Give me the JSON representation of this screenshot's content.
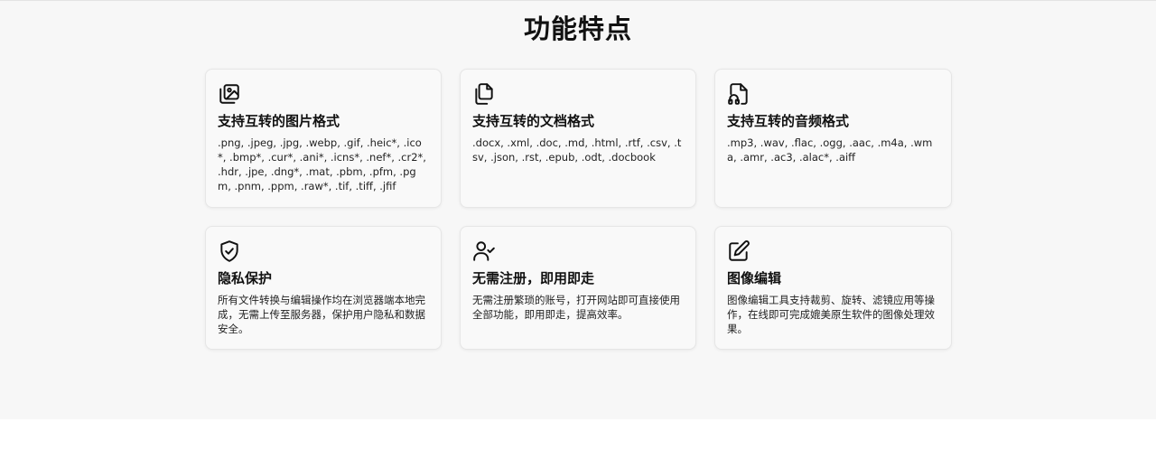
{
  "section": {
    "title": "功能特点"
  },
  "features": [
    {
      "icon": "image-gallery-icon",
      "title": "支持互转的图片格式",
      "description": ".png, .jpeg, .jpg, .webp, .gif, .heic*, .ico*, .bmp*, .cur*, .ani*, .icns*, .nef*, .cr2*, .hdr, .jpe, .dng*, .mat, .pbm, .pfm, .pgm, .pnm, .ppm, .raw*, .tif, .tiff, .jfif"
    },
    {
      "icon": "documents-icon",
      "title": "支持互转的文档格式",
      "description": ".docx, .xml, .doc, .md, .html, .rtf, .csv, .tsv, .json, .rst, .epub, .odt, .docbook"
    },
    {
      "icon": "audio-file-icon",
      "title": "支持互转的音频格式",
      "description": ".mp3, .wav, .flac, .ogg, .aac, .m4a, .wma, .amr, .ac3, .alac*, .aiff"
    },
    {
      "icon": "shield-check-icon",
      "title": "隐私保护",
      "description": "所有文件转换与编辑操作均在浏览器端本地完成，无需上传至服务器，保护用户隐私和数据安全。"
    },
    {
      "icon": "user-check-icon",
      "title": "无需注册，即用即走",
      "description": "无需注册繁琐的账号，打开网站即可直接使用全部功能，即用即走，提高效率。"
    },
    {
      "icon": "edit-icon",
      "title": "图像编辑",
      "description": "图像编辑工具支持裁剪、旋转、滤镜应用等操作，在线即可完成媲美原生软件的图像处理效果。"
    }
  ]
}
